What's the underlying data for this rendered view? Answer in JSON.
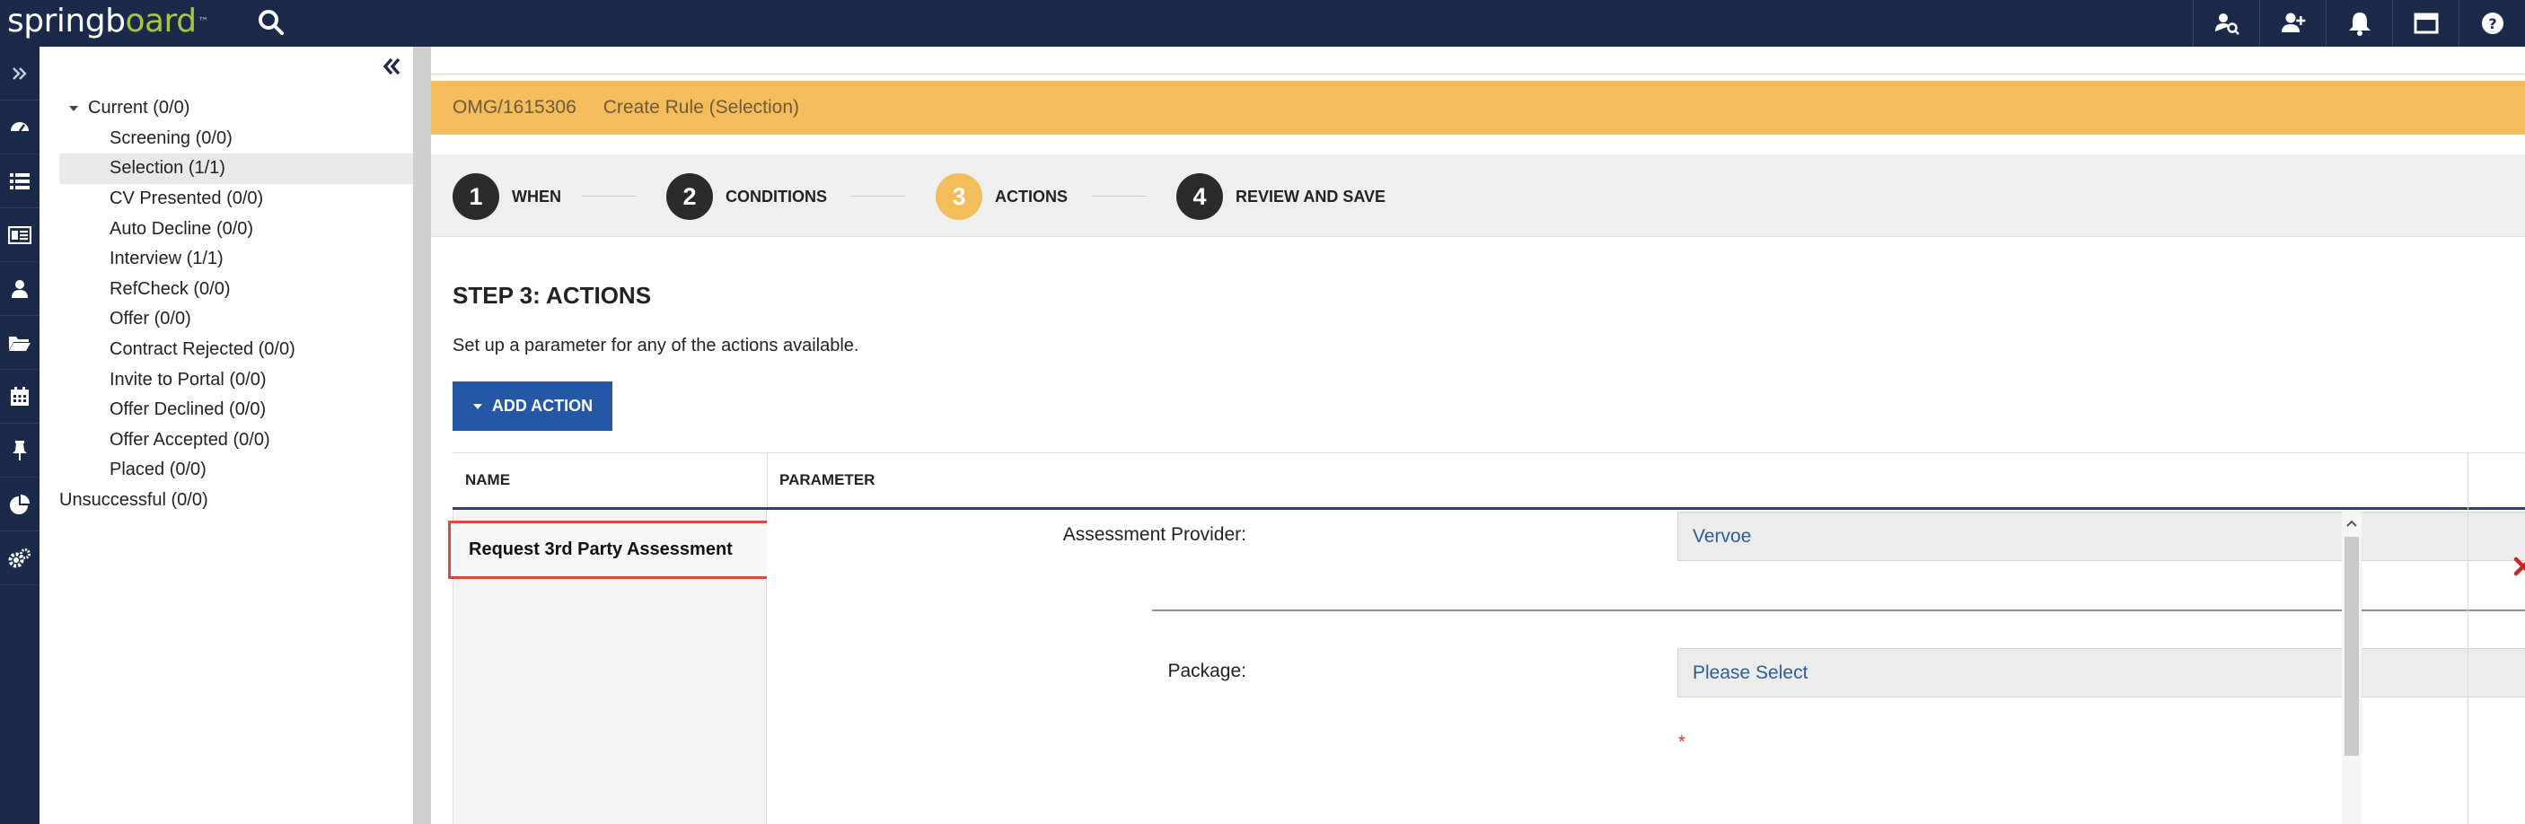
{
  "app": {
    "logo_main": "springb",
    "logo_tail": "oard",
    "logo_mark": "™"
  },
  "header": {
    "icons": [
      "candidate-search-icon",
      "add-person-icon",
      "bell-icon",
      "window-icon",
      "help-icon"
    ]
  },
  "rail": {
    "icons": [
      "expand-icon",
      "dashboard-icon",
      "list-icon",
      "id-card-icon",
      "person-icon",
      "folder-icon",
      "calendar-icon",
      "pin-icon",
      "pie-chart-icon",
      "settings-icon"
    ]
  },
  "tree": {
    "current": "Current (0/0)",
    "children": [
      "Screening (0/0)",
      "Selection (1/1)",
      "CV Presented (0/0)",
      "Auto Decline (0/0)",
      "Interview (1/1)",
      "RefCheck (0/0)",
      "Offer (0/0)",
      "Contract Rejected (0/0)",
      "Invite to Portal (0/0)",
      "Offer Declined (0/0)",
      "Offer Accepted (0/0)",
      "Placed (0/0)"
    ],
    "selected_index": 1,
    "unsuccessful": "Unsuccessful (0/0)"
  },
  "banner": {
    "job_code": "OMG/1615306",
    "title": "Create Rule (Selection)"
  },
  "steps": [
    {
      "num": "1",
      "label": "WHEN"
    },
    {
      "num": "2",
      "label": "CONDITIONS"
    },
    {
      "num": "3",
      "label": "ACTIONS"
    },
    {
      "num": "4",
      "label": "REVIEW AND SAVE"
    }
  ],
  "content": {
    "title": "STEP 3: ACTIONS",
    "subtitle": "Set up a parameter for any of the actions available.",
    "add_action": "ADD ACTION"
  },
  "table": {
    "col_name": "NAME",
    "col_parameter": "PARAMETER",
    "action_name": "Request 3rd Party Assessment",
    "provider_label": "Assessment Provider:",
    "provider_value": "Vervoe",
    "package_label": "Package:",
    "package_value": "Please Select",
    "required_marker": "*"
  },
  "colors": {
    "nav": "#1b2a4a",
    "banner": "#f3bd5c",
    "primary_button": "#2557a7",
    "highlight_border": "#d94b3f",
    "delete": "#c62828"
  }
}
